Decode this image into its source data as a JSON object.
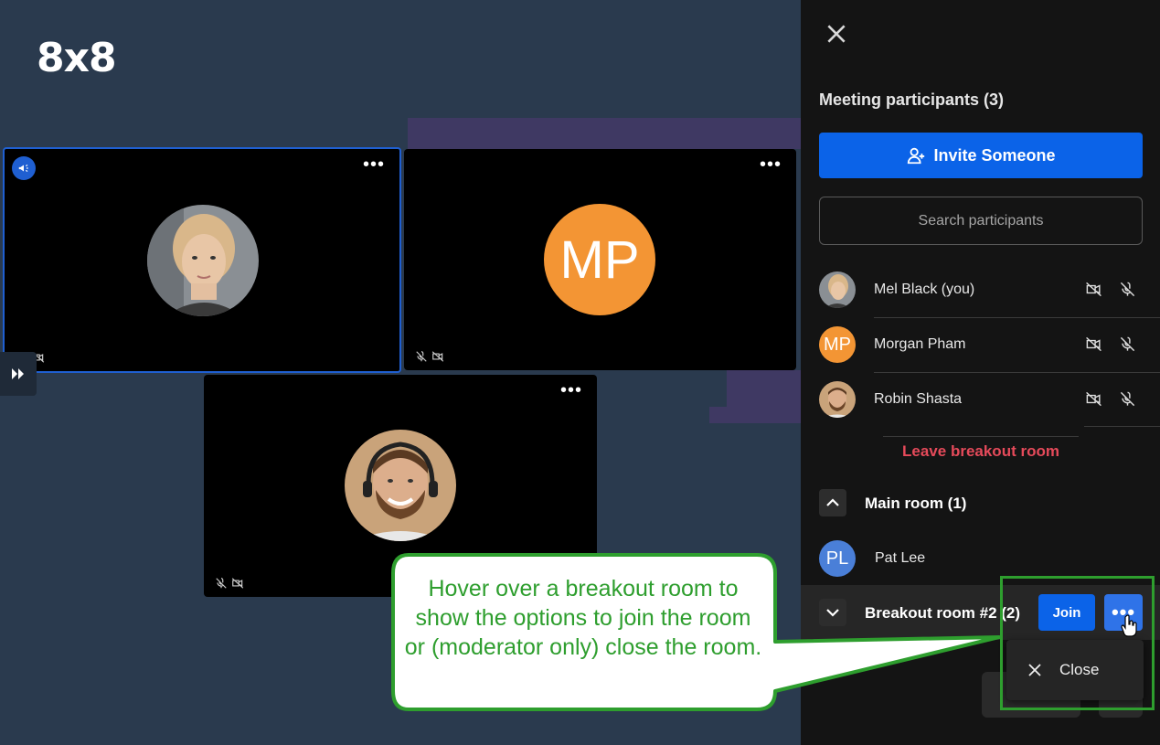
{
  "logo": "8x8",
  "tiles": {
    "mp_initials": "MP"
  },
  "panel": {
    "title": "Meeting participants (3)",
    "invite_label": "Invite Someone",
    "search_placeholder": "Search participants",
    "participants": [
      {
        "name": "Mel Black (you)",
        "avatar": "photo"
      },
      {
        "name": "Morgan Pham",
        "avatar": "MP"
      },
      {
        "name": "Robin Shasta",
        "avatar": "photo"
      }
    ],
    "leave_label": "Leave breakout room",
    "main_room": {
      "label": "Main room (1)",
      "member": "Pat Lee",
      "member_initials": "PL"
    },
    "breakout_room": {
      "label": "Breakout room #2 (2)",
      "join_label": "Join",
      "more_label": "•••"
    },
    "dropdown": {
      "close_label": "Close"
    }
  },
  "callout": {
    "text": "Hover over a breakout room to show the options to join the room or (moderator only) close the room."
  },
  "colors": {
    "accent": "#0b63e8",
    "danger": "#e54a5a",
    "annotation": "#2e9e2e",
    "avatar_orange": "#f39534",
    "avatar_blue": "#4a7fd8"
  }
}
